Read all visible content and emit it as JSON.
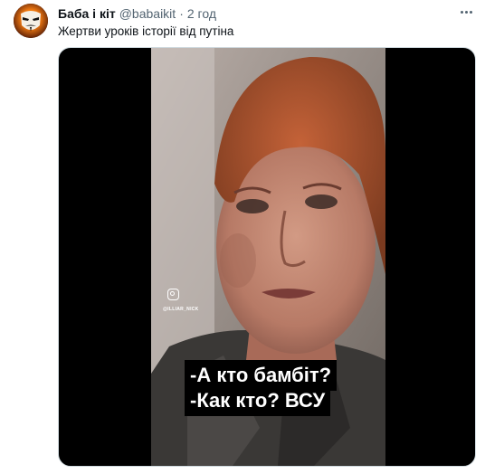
{
  "tweet": {
    "display_name": "Баба і кіт",
    "handle": "@babaikit",
    "separator": "·",
    "time": "2 год",
    "text": "Жертви уроків історії від путіна",
    "avatar_icon": "masked-face-avatar-icon",
    "more_icon": "more-options-icon"
  },
  "media": {
    "watermark": "@ILLIAR_NICK",
    "watermark_icon": "instagram-icon",
    "caption_line1": "-А кто бамбіт?",
    "caption_line2": "-Как кто? ВСУ"
  },
  "colors": {
    "text_primary": "#0f1419",
    "text_secondary": "#536471",
    "media_background": "#000000",
    "border": "#cfd9de"
  }
}
